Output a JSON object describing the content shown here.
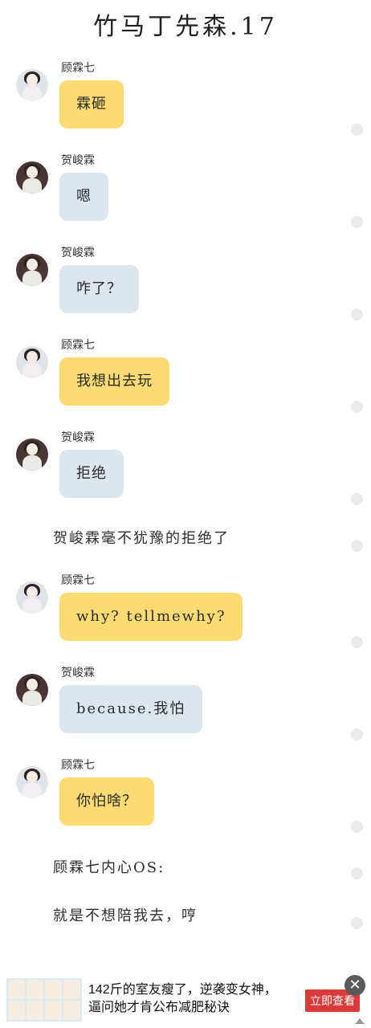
{
  "title": "竹马丁先森.17",
  "messages": [
    {
      "sender": "顾霖七",
      "text": "霖砸",
      "bubble_color": "#fbdb72"
    },
    {
      "sender": "贺峻霖",
      "text": "嗯",
      "bubble_color": "#dde6ee"
    },
    {
      "sender": "贺峻霖",
      "text": "咋了？",
      "bubble_color": "#dde6ee"
    },
    {
      "sender": "顾霖七",
      "text": "我想出去玩",
      "bubble_color": "#fbdb72"
    },
    {
      "sender": "贺峻霖",
      "text": "拒绝",
      "bubble_color": "#dde6ee"
    },
    {
      "sender": "顾霖七",
      "text": "why? tellmewhy?",
      "bubble_color": "#fbdb72"
    },
    {
      "sender": "贺峻霖",
      "text": "because.我怕",
      "bubble_color": "#dde6ee"
    },
    {
      "sender": "顾霖七",
      "text": "你怕啥？",
      "bubble_color": "#fbdb72"
    }
  ],
  "narrations": [
    "贺峻霖毫不犹豫的拒绝了",
    "顾霖七内心OS:",
    "就是不想陪我去，哼"
  ],
  "ad": {
    "text_line1": "142斤的室友瘦了，逆袭变女神，",
    "text_line2": "逼问她才肯公布减肥秘诀",
    "button": "立即查看",
    "close_icon": "close-icon",
    "ad_mark_icon": "ad-mark-icon"
  }
}
